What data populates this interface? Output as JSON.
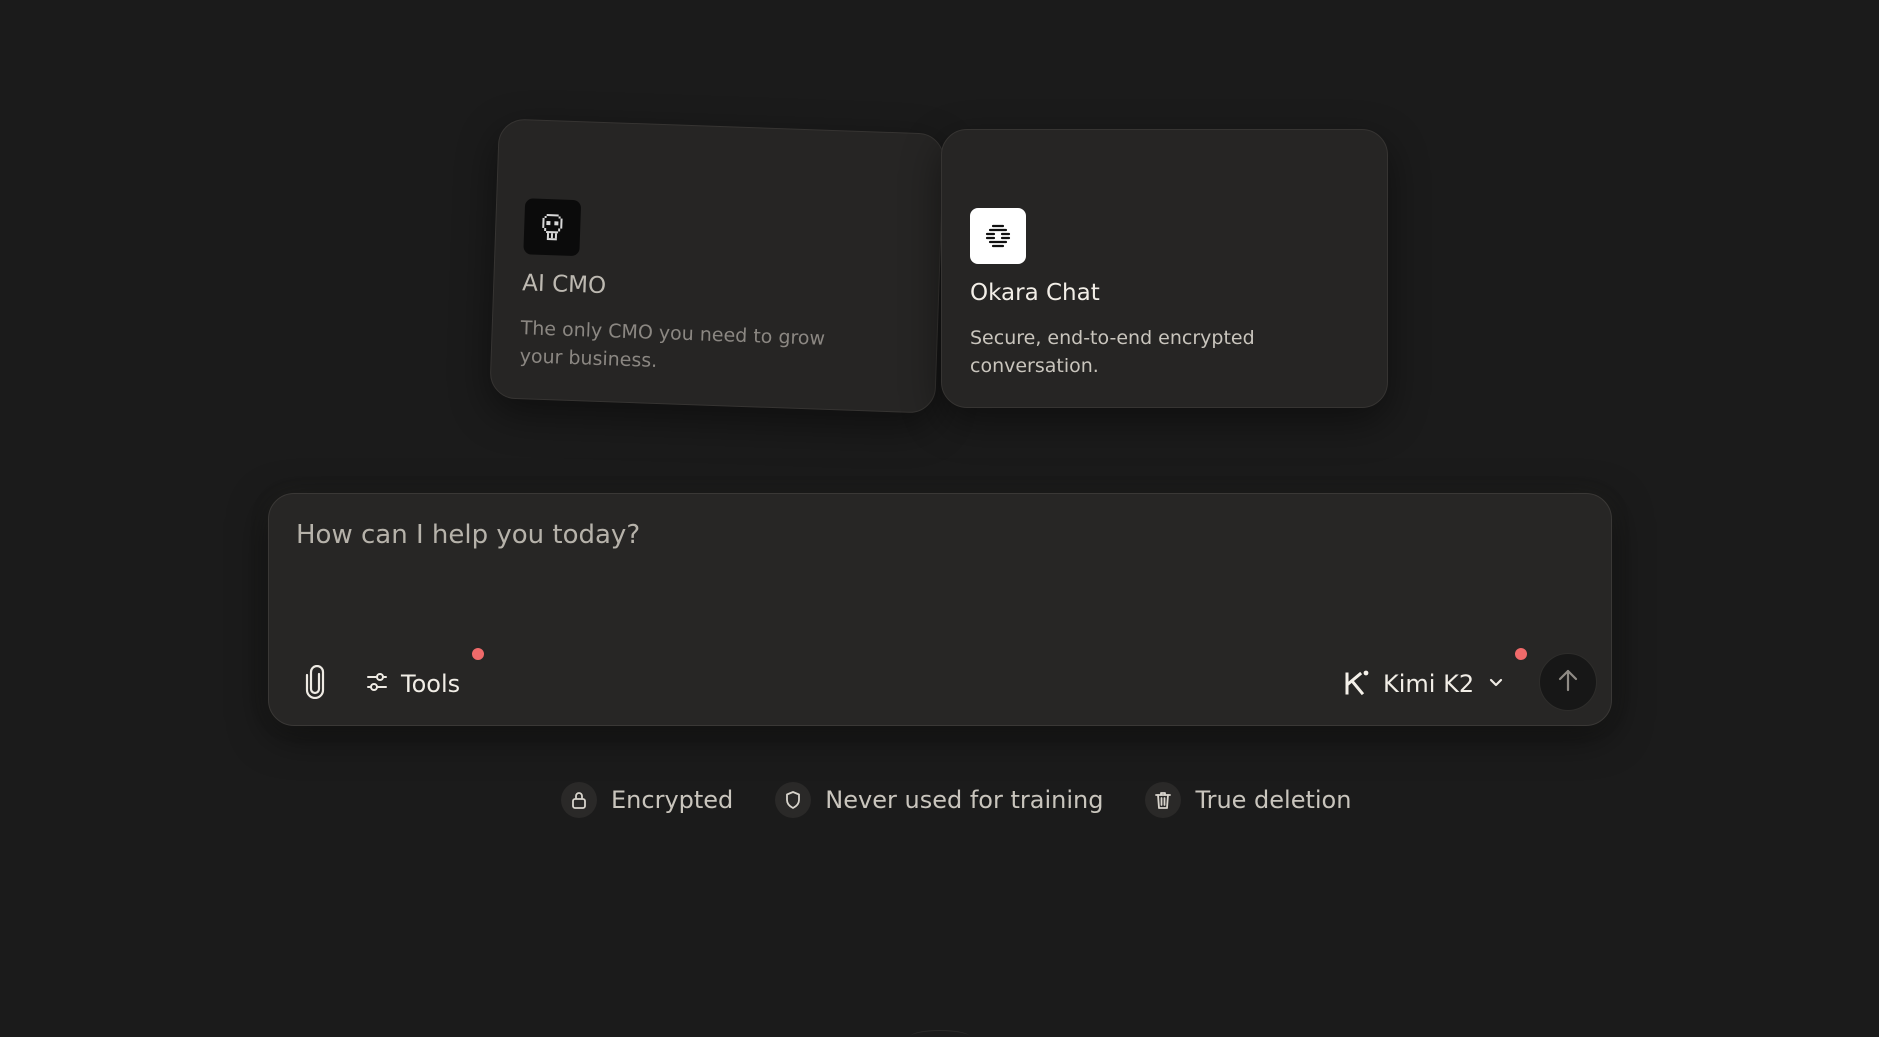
{
  "cards": [
    {
      "title": "AI CMO",
      "description": "The only CMO you need to grow your business.",
      "icon": "skull-icon"
    },
    {
      "title": "Okara Chat",
      "description": "Secure, end-to-end encrypted conversation.",
      "icon": "okara-logo-icon"
    }
  ],
  "composer": {
    "placeholder": "How can I help you today?",
    "tools_label": "Tools",
    "model_label": "Kimi K2",
    "attach_icon": "paperclip-icon",
    "tools_icon": "sliders-icon",
    "model_icon": "kimi-logo-icon",
    "dropdown_icon": "chevron-down-icon",
    "send_icon": "arrow-up-icon",
    "notification_color": "#f06a6a"
  },
  "badges": [
    {
      "label": "Encrypted",
      "icon": "lock-icon"
    },
    {
      "label": "Never used for training",
      "icon": "shield-icon"
    },
    {
      "label": "True deletion",
      "icon": "trash-icon"
    }
  ]
}
